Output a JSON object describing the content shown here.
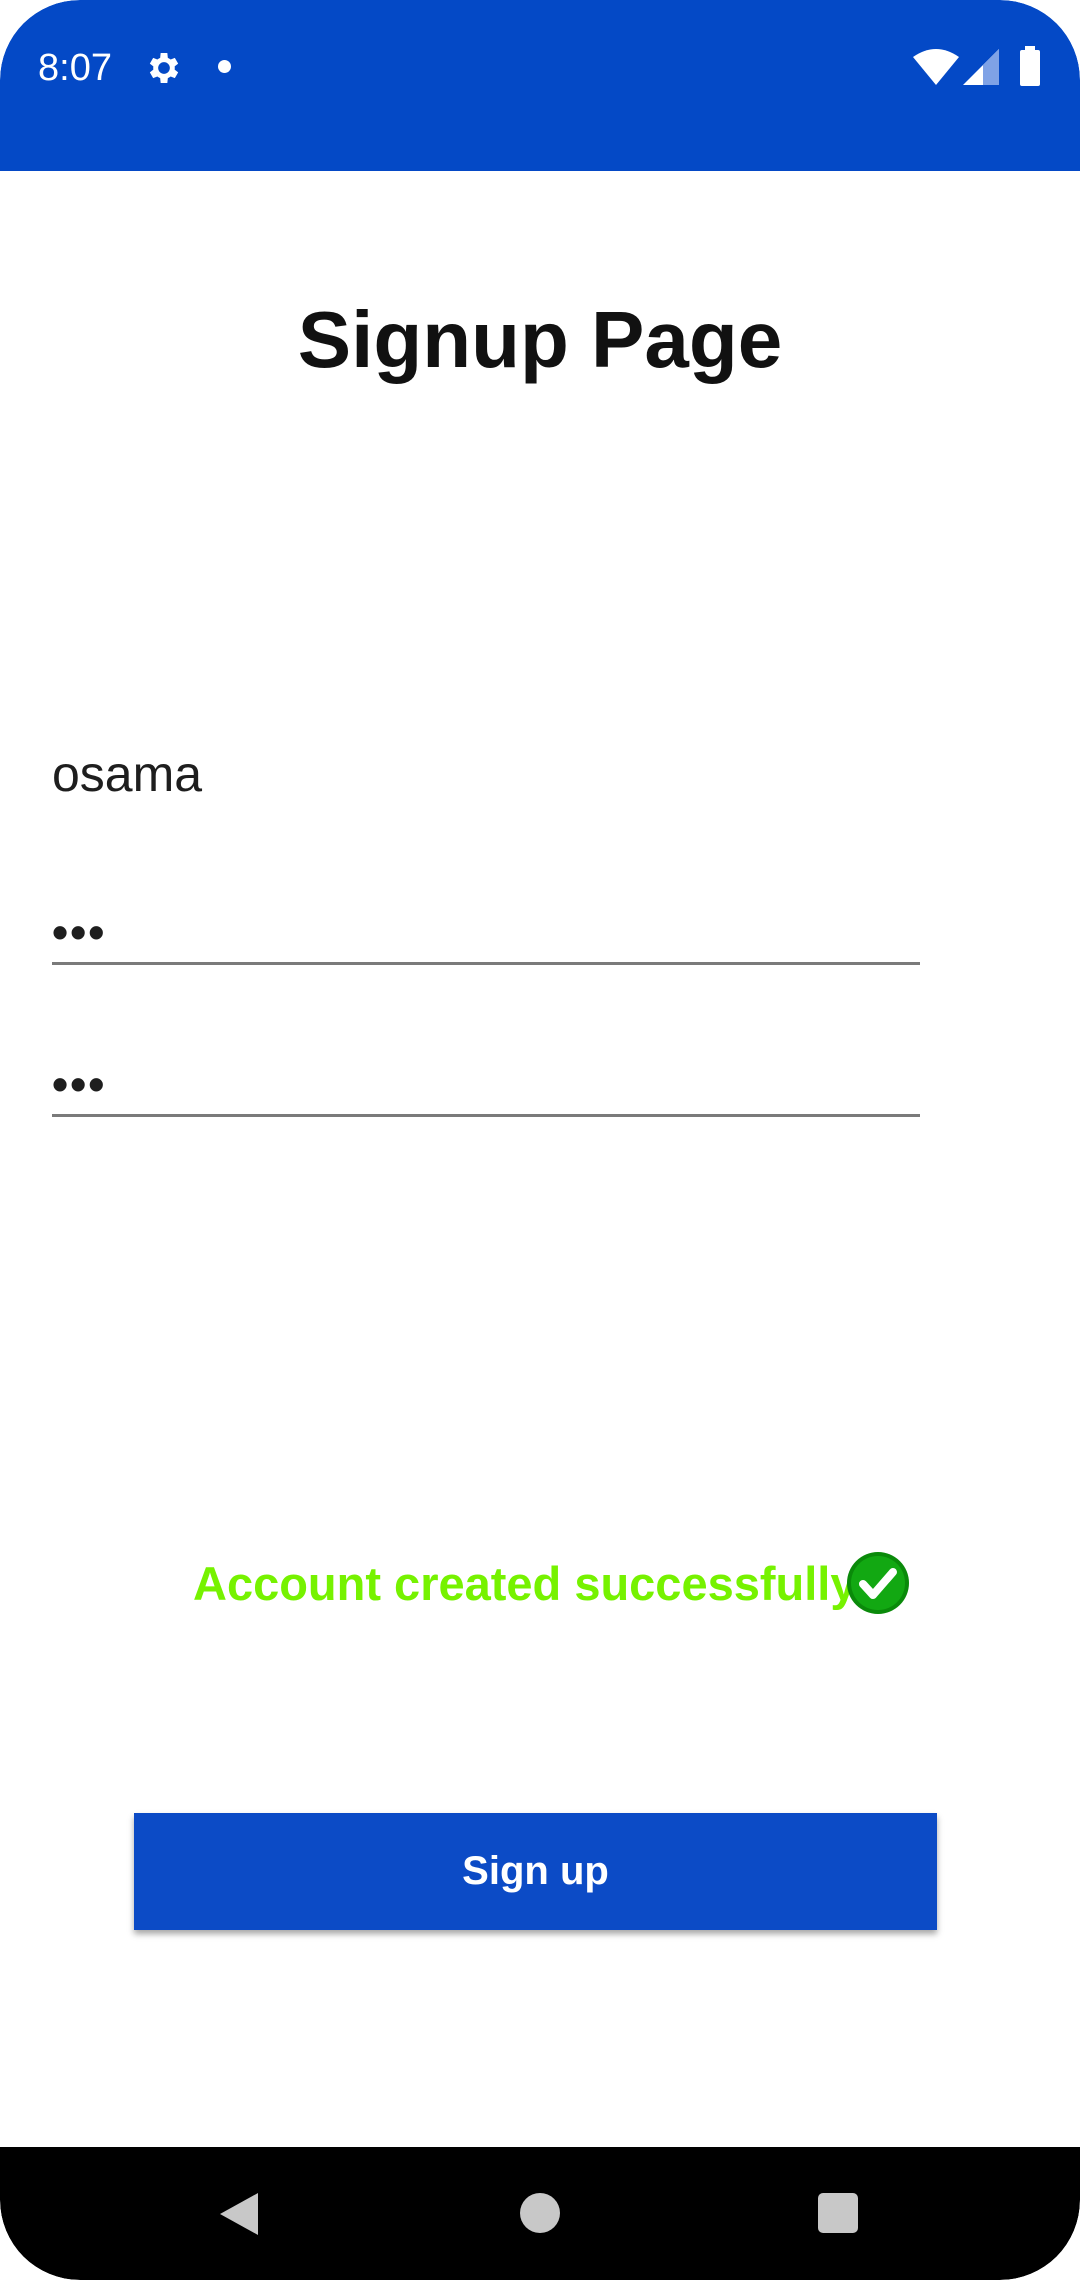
{
  "status_bar": {
    "time": "8:07",
    "color": "#0449C6"
  },
  "page": {
    "title": "Signup Page",
    "username": "osama",
    "password": "•••",
    "confirm_password": "•••"
  },
  "message": {
    "text": "Account created successfully",
    "color": "#76F200",
    "icon": "check-circle-icon"
  },
  "actions": {
    "signup_label": "Sign up",
    "button_color": "#0C4BC6"
  },
  "nav_bar": {
    "icons": [
      "back-icon",
      "home-icon",
      "recents-icon"
    ]
  }
}
